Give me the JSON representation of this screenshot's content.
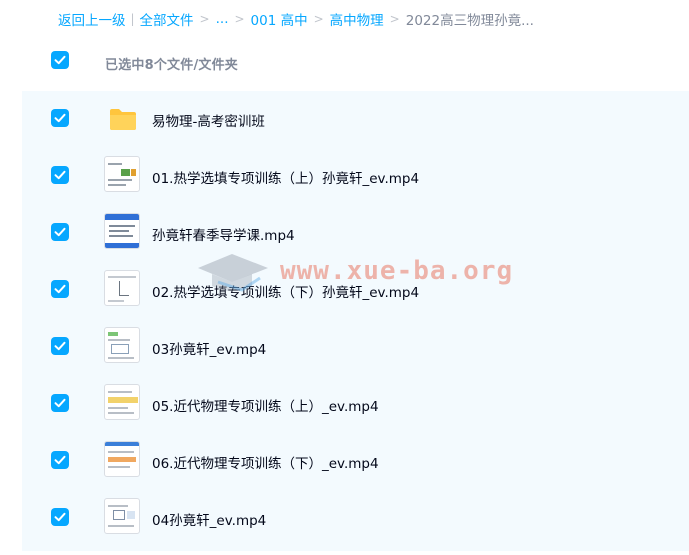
{
  "breadcrumb": {
    "back": "返回上一级",
    "items": [
      "全部文件",
      "...",
      "001 高中",
      "高中物理",
      "2022高三物理孙竟..."
    ]
  },
  "selection": {
    "label": "已选中8个文件/文件夹"
  },
  "files": [
    {
      "name": "易物理-高考密训班",
      "type": "folder",
      "icon": "folder-icon",
      "checked": true
    },
    {
      "name": "01.热学选填专项训练（上）孙竟轩_ev.mp4",
      "type": "video",
      "icon": "video-thumbnail",
      "checked": true
    },
    {
      "name": "孙竟轩春季导学课.mp4",
      "type": "video",
      "icon": "video-thumbnail",
      "checked": true
    },
    {
      "name": "02.热学选填专项训练（下）孙竟轩_ev.mp4",
      "type": "video",
      "icon": "video-thumbnail",
      "checked": true
    },
    {
      "name": "03孙竟轩_ev.mp4",
      "type": "video",
      "icon": "video-thumbnail",
      "checked": true
    },
    {
      "name": "05.近代物理专项训练（上）_ev.mp4",
      "type": "video",
      "icon": "video-thumbnail",
      "checked": true
    },
    {
      "name": "06.近代物理专项训练（下）_ev.mp4",
      "type": "video",
      "icon": "video-thumbnail",
      "checked": true
    },
    {
      "name": "04孙竟轩_ev.mp4",
      "type": "video",
      "icon": "video-thumbnail",
      "checked": true
    }
  ],
  "watermark": {
    "text": "www.xue-ba.org"
  },
  "colors": {
    "accent": "#06a7ff",
    "list_background": "#f3fafe",
    "muted_text": "#818999",
    "folder_yellow": "#ffc53d"
  }
}
